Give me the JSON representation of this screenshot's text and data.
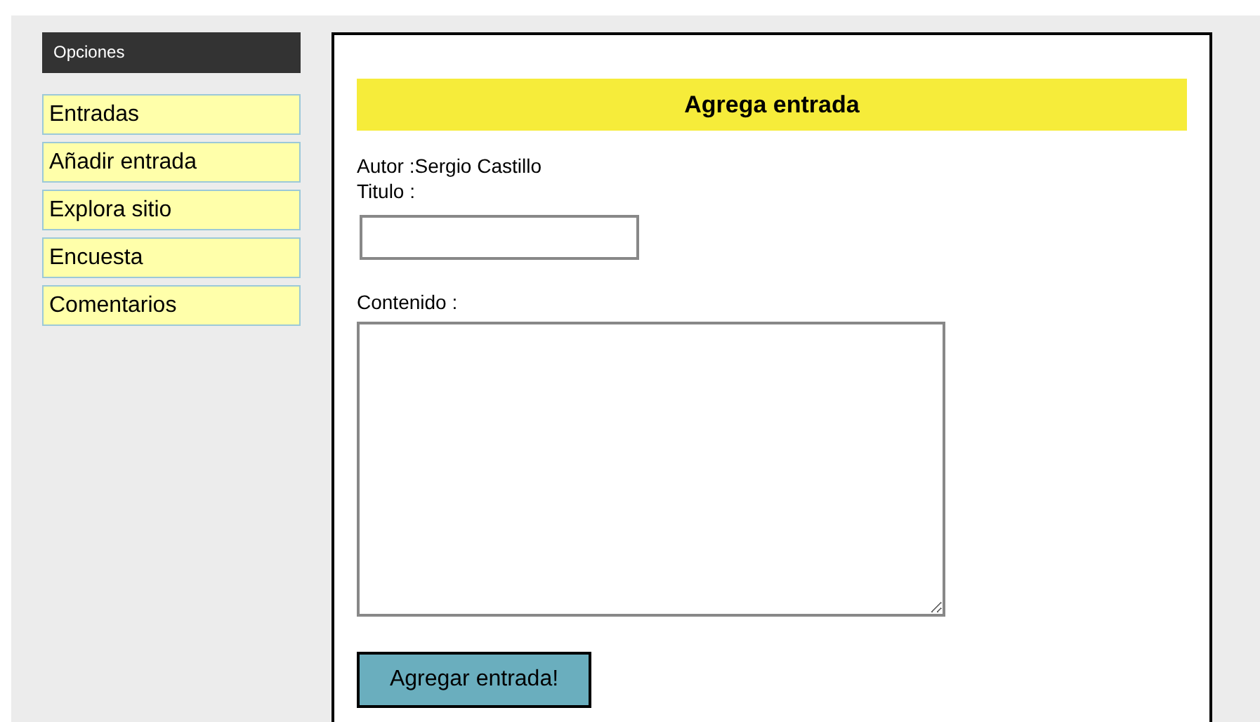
{
  "sidebar": {
    "title": "Opciones",
    "items": [
      {
        "label": "Entradas"
      },
      {
        "label": "Añadir entrada"
      },
      {
        "label": "Explora sitio"
      },
      {
        "label": "Encuesta"
      },
      {
        "label": "Comentarios"
      }
    ]
  },
  "form": {
    "heading": "Agrega entrada",
    "author": "Autor :Sergio Castillo",
    "title_label": "Titulo :",
    "content_label": "Contenido :",
    "submit": "Agregar entrada!"
  }
}
